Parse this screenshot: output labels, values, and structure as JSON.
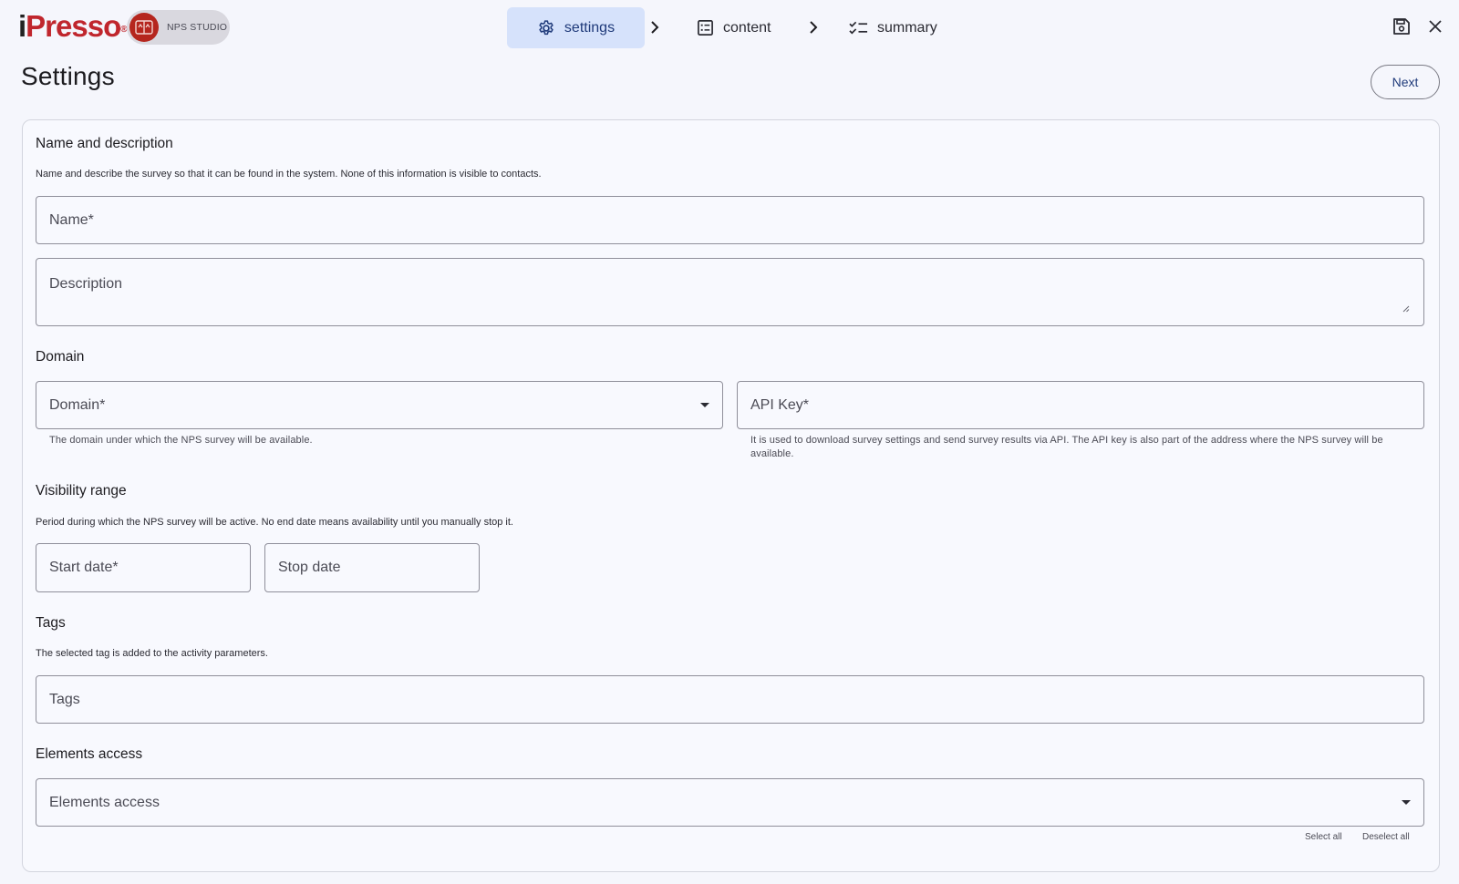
{
  "brand": {
    "logo_i": "i",
    "logo_rest": "Presso",
    "logo_reg": "®",
    "studio_label": "NPS STUDIO"
  },
  "steps": [
    {
      "label": "settings",
      "icon": "gear-icon",
      "active": true
    },
    {
      "label": "content",
      "icon": "list-icon",
      "active": false
    },
    {
      "label": "summary",
      "icon": "checklist-icon",
      "active": false
    }
  ],
  "actions": {
    "save_icon": "save-icon",
    "close_icon": "close-icon"
  },
  "header": {
    "title": "Settings",
    "next_label": "Next"
  },
  "name_section": {
    "title": "Name and description",
    "description": "Name and describe the survey so that it can be found in the system. None of this information is visible to contacts.",
    "name_placeholder": "Name*",
    "description_placeholder": "Description"
  },
  "domain_section": {
    "title": "Domain",
    "domain_placeholder": "Domain*",
    "domain_hint": "The domain under which the NPS survey will be available.",
    "api_key_placeholder": "API Key*",
    "api_key_hint": "It is used to download survey settings and send survey results via API. The API key is also part of the address where the NPS survey will be available."
  },
  "visibility_section": {
    "title": "Visibility range",
    "description": "Period during which the NPS survey will be active. No end date means availability until you manually stop it.",
    "start_placeholder": "Start date*",
    "stop_placeholder": "Stop date"
  },
  "tags_section": {
    "title": "Tags",
    "description": "The selected tag is added to the activity parameters.",
    "tags_placeholder": "Tags"
  },
  "access_section": {
    "title": "Elements access",
    "access_placeholder": "Elements access",
    "select_all": "Select all",
    "deselect_all": "Deselect all"
  },
  "colors": {
    "accent": "#1f3a7a",
    "active_step_bg": "#d6e2fb",
    "brand_red": "#c0262d",
    "background": "#f5f6fc"
  }
}
